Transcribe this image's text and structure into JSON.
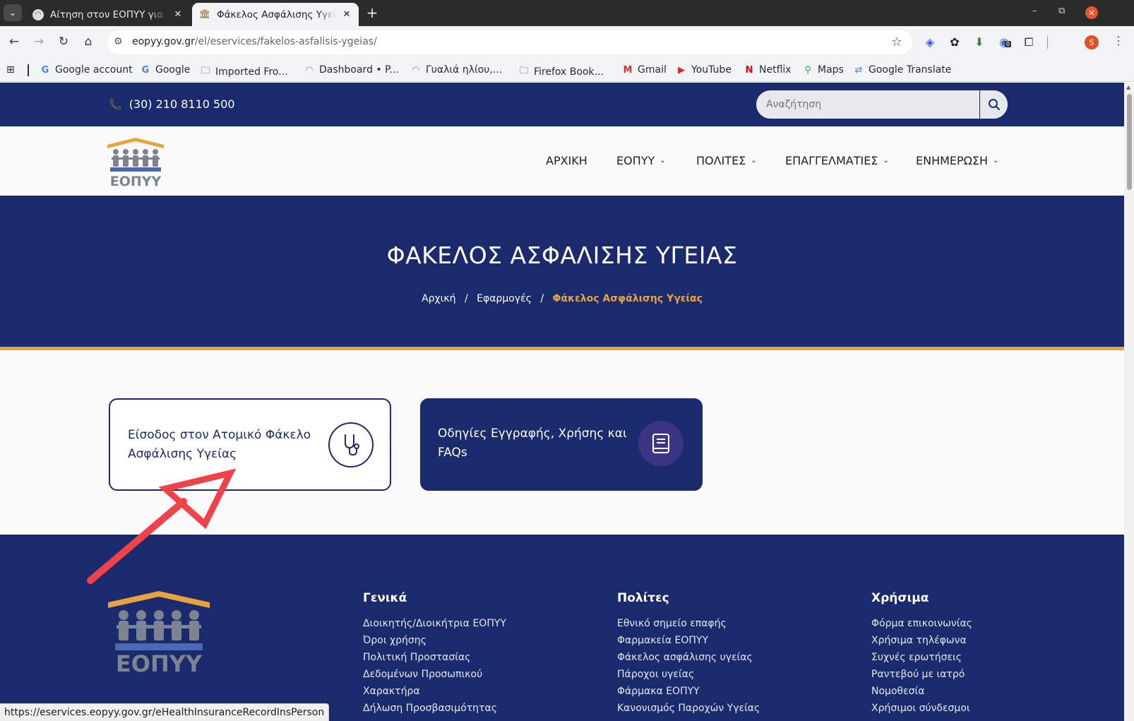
{
  "browser": {
    "tabs": [
      {
        "title": "Αίτηση στον ΕΟΠΥΥ για ν",
        "active": false
      },
      {
        "title": "Φάκελος Ασφάλισης Υγεία",
        "active": true
      }
    ],
    "url_host": "eopyy.gov.gr",
    "url_path": "/el/eservices/fakelos-asfalisis-ygeias/",
    "profile_initial": "S",
    "extension_badge": "0",
    "bookmarks": [
      {
        "label": "Google account",
        "icon": "google-icon"
      },
      {
        "label": "Google",
        "icon": "google-icon"
      },
      {
        "label": "Imported Fro...",
        "icon": "folder-icon"
      },
      {
        "label": "Dashboard • P...",
        "icon": "site-icon"
      },
      {
        "label": "Γυαλιά ηλίου,...",
        "icon": "site-icon"
      },
      {
        "label": "Firefox Book...",
        "icon": "folder-icon"
      },
      {
        "label": "Gmail",
        "icon": "gmail-icon"
      },
      {
        "label": "YouTube",
        "icon": "youtube-icon"
      },
      {
        "label": "Netflix",
        "icon": "netflix-icon"
      },
      {
        "label": "Maps",
        "icon": "maps-icon"
      },
      {
        "label": "Google Translate",
        "icon": "translate-icon"
      }
    ],
    "status_url": "https://eservices.eopyy.gov.gr/eHealthInsuranceRecordInsPerson"
  },
  "site": {
    "phone": "(30) 210 8110 500",
    "search_placeholder": "Αναζήτηση",
    "logo_text": "ΕΟΠΥΥ",
    "nav": [
      {
        "label": "ΑΡΧΙΚΗ",
        "dropdown": false
      },
      {
        "label": "ΕΟΠΥΥ",
        "dropdown": true
      },
      {
        "label": "ΠΟΛΙΤΕΣ",
        "dropdown": true
      },
      {
        "label": "ΕΠΑΓΓΕΛΜΑΤΙΕΣ",
        "dropdown": true
      },
      {
        "label": "ΕΝΗΜΕΡΩΣΗ",
        "dropdown": true
      }
    ]
  },
  "hero": {
    "title": "ΦΑΚΕΛΟΣ ΑΣΦΑΛΙΣΗΣ ΥΓΕΙΑΣ",
    "breadcrumb": [
      "Αρχική",
      "Εφαρμογές",
      "Φάκελος Ασφάλισης Υγείας"
    ]
  },
  "cards": [
    {
      "label": "Είσοδος στον Ατομικό Φάκελο Ασφάλισης Υγείας",
      "icon": "stethoscope-icon"
    },
    {
      "label": "Οδηγίες Εγγραφής, Χρήσης και FAQs",
      "icon": "book-icon"
    }
  ],
  "footer": {
    "columns": [
      {
        "heading": "Γενικά",
        "links": [
          "Διοικητής/Διοικήτρια ΕΟΠΥΥ",
          "Όροι χρήσης",
          "Πολιτική Προστασίας",
          "Δεδομένων Προσωπικού",
          "Χαρακτήρα",
          "Δήλωση Προσβασιμότητας"
        ]
      },
      {
        "heading": "Πολίτες",
        "links": [
          "Εθνικό σημείο επαφής",
          "Φαρμακεία ΕΟΠΥΥ",
          "Φάκελος ασφάλισης υγείας",
          "Πάροχοι υγείας",
          "Φάρμακα ΕΟΠΥΥ",
          "Κανονισμός Παροχών Υγείας"
        ]
      },
      {
        "heading": "Χρήσιμα",
        "links": [
          "Φόρμα επικοινωνίας",
          "Χρήσιμα τηλέφωνα",
          "Συχνές ερωτήσεις",
          "Ραντεβού με ιατρό",
          "Νομοθεσία",
          "Χρήσιμοι σύνδεσμοι"
        ]
      }
    ]
  },
  "colors": {
    "brand_navy": "#1a2a6c",
    "accent_orange": "#e8a33d",
    "annotation_red": "#f0424a"
  }
}
